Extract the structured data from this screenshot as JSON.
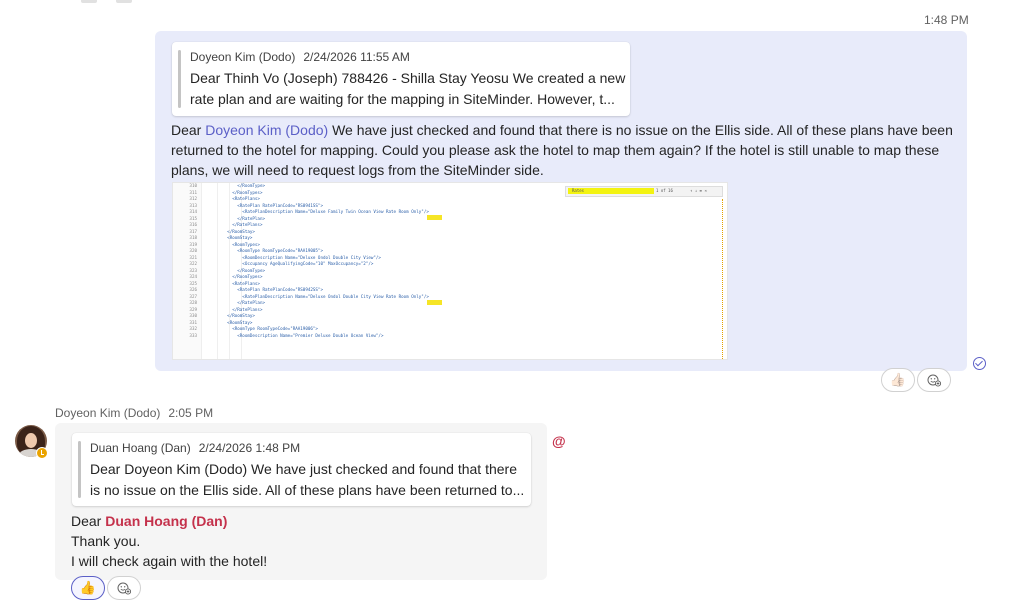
{
  "message_mine": {
    "time": "1:48 PM",
    "quote": {
      "author": "Doyeon Kim (Dodo)",
      "timestamp": "2/24/2026 11:55 AM",
      "line1": "Dear Thinh Vo (Joseph) 788426 - Shilla Stay Yeosu We created a new",
      "line2": "rate plan and are waiting for the mapping in SiteMinder. However, t..."
    },
    "greeting": "Dear",
    "mention": "Doyeon Kim (Dodo)",
    "line1_rest": " We have just checked and found that there is no issue on the Ellis side. All of these plans have been",
    "line2": "returned to the hotel for mapping. Could you please ask the hotel to map them again? If the hotel is still unable to map these",
    "line3": "plans, we will need to request logs from the SiteMinder side.",
    "attachment": {
      "line_numbers": [
        "310",
        "311",
        "312",
        "313",
        "314",
        "315",
        "316",
        "317",
        "318",
        "319",
        "320",
        "321",
        "322",
        "323",
        "324",
        "325",
        "326",
        "327",
        "328",
        "329",
        "330",
        "331",
        "332",
        "333"
      ],
      "code_lines": [
        "            </RoomType>",
        "          </RoomTypes>",
        "          <RatePlans>",
        "            <RatePlan RatePlanCode=\"RS0941SS\">",
        "              <RatePlanDescription Name=\"Deluxe Family Twin Ocean View Rate Room Only\"/>",
        "            </RatePlan>",
        "          </RatePlans>",
        "        </RoomStay>",
        "        <RoomStay>",
        "          <RoomTypes>",
        "            <RoomType RoomTypeCode=\"RAA19005\">",
        "              <RoomDescription Name=\"Deluxe Ondol Double City View\"/>",
        "              <Occupancy AgeQualifyingCode=\"10\" MaxOccupancy=\"2\"/>",
        "            </RoomType>",
        "          </RoomTypes>",
        "          <RatePlans>",
        "            <RatePlan RatePlanCode=\"RS0942SS\">",
        "              <RatePlanDescription Name=\"Deluxe Ondol Double City View Rate Room Only\"/>",
        "            </RatePlan>",
        "          </RatePlans>",
        "        </RoomStay>",
        "        <RoomStay>",
        "          <RoomType RoomTypeCode=\"RAA19006\">",
        "            <RoomDescription Name=\"Premier Deluxe Double Ocean View\"/>"
      ],
      "search_text": "Rates",
      "search_counter": "1 of 16"
    }
  },
  "message_other": {
    "sender": "Doyeon Kim (Dodo)",
    "time": "2:05 PM",
    "quote": {
      "author": "Duan Hoang (Dan)",
      "timestamp": "2/24/2026 1:48 PM",
      "line1": "Dear Doyeon Kim (Dodo) We have just checked and found that there",
      "line2": "is no issue on the Ellis side. All of these plans have been returned to..."
    },
    "greeting": "Dear",
    "mention": "Duan Hoang (Dan)",
    "line2": "Thank you.",
    "line3": "I will check again with the hotel!",
    "mention_indicator": "@"
  },
  "reactions": {
    "like_emoji": "👍",
    "add_reaction_icon": "emoji-add-icon"
  },
  "colors": {
    "my_bubble": "#e8ebfa",
    "other_bubble": "#f5f5f5",
    "mention_blue": "#5b5fc7",
    "mention_red": "#c4314b",
    "status_away": "#eaa300"
  }
}
